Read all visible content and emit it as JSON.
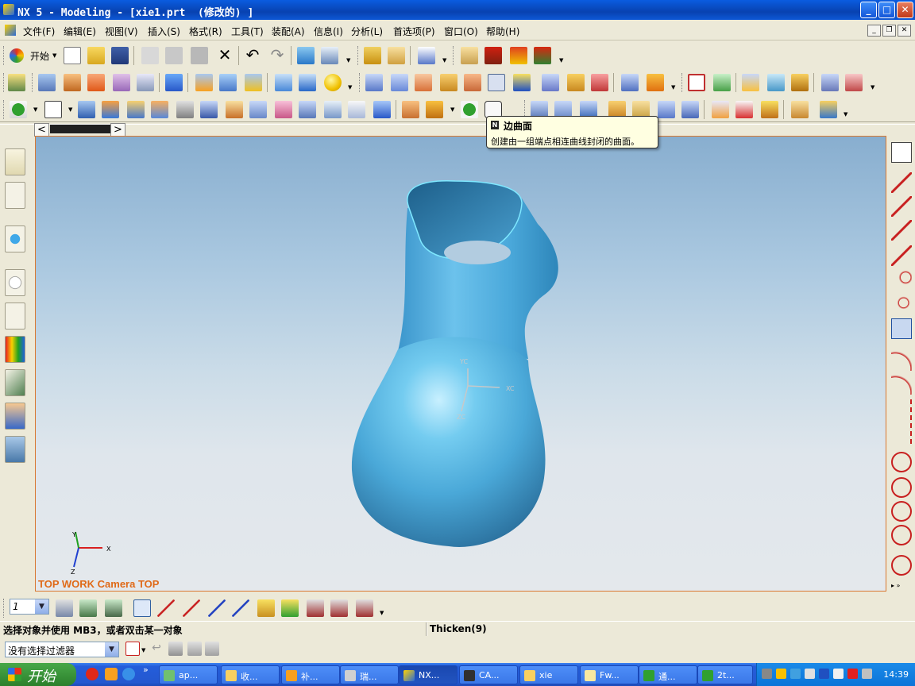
{
  "window": {
    "title": "NX 5 - Modeling - [xie1.prt  (修改的) ]",
    "minimize": "_",
    "maximize": "□",
    "close": "✕"
  },
  "menu": {
    "items": [
      "文件(F)",
      "编辑(E)",
      "视图(V)",
      "插入(S)",
      "格式(R)",
      "工具(T)",
      "装配(A)",
      "信息(I)",
      "分析(L)",
      "首选项(P)",
      "窗口(O)",
      "帮助(H)"
    ],
    "start_label": "开始",
    "mdi": [
      "_",
      "❐",
      "✕"
    ]
  },
  "tooltip": {
    "title": "边曲面",
    "description": "创建由一组端点相连曲线封闭的曲面。"
  },
  "viewport": {
    "view_label": "TOP WORK Camera TOP",
    "axis_x": "X",
    "axis_y": "Y",
    "axis_z": "Z",
    "wcs_xc": "XC",
    "wcs_yc": "YC",
    "wcs_zc": "ZC"
  },
  "bottom_toolbar": {
    "layer_value": "1"
  },
  "status": {
    "prompt": "选择对象并使用 MB3，或者双击某一对象",
    "message": "Thicken(9)"
  },
  "filter": {
    "selected": "没有选择过滤器"
  },
  "taskbar": {
    "start": "开始",
    "tasks": [
      "ap...",
      "收...",
      "补...",
      "瑞...",
      "NX...",
      "CA...",
      "xie",
      "Fw...",
      "通...",
      "2t..."
    ],
    "clock": "14:39"
  },
  "colors": {
    "shape": "#5cb4e2",
    "view_label": "#e06a18",
    "viewport_border": "#d87830",
    "tooltip_bg": "#ffffe1"
  }
}
